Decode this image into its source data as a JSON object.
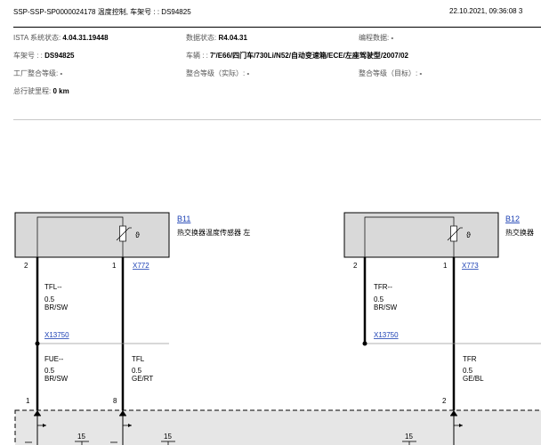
{
  "header": {
    "left": "SSP-SSP-SP0000024178 温度控制, 车架号 : : DS94825",
    "right": "22.10.2021, 09:36:08  3"
  },
  "info": {
    "istatus_label": "ISTA 系统状态: ",
    "istatus_value": "4.04.31.19448",
    "data_label": "数据状态: ",
    "data_value": "R4.04.31",
    "prog_label": "编程数据: ",
    "prog_value": "-",
    "vin_label": "车架号 : : ",
    "vin_value": "DS94825",
    "vehicle_label": "车辆 : : ",
    "vehicle_value": "7'/E66/四门车/730Li/N52/自动变速箱/ECE/左座驾驶型/2007/02",
    "factory_label": "工厂整合等级: ",
    "factory_value": "-",
    "actual_label": "整合等级（实际）: ",
    "actual_value": "-",
    "target_label": "整合等级（目标）: ",
    "target_value": "-",
    "mileage_label": "总行驶里程: ",
    "mileage_value": "0 km"
  },
  "diagram": {
    "left_component": {
      "ref": "B11",
      "description": "热交换器温度传感器 左",
      "pin_left": "2",
      "pin_right": "1",
      "connector": "X772",
      "wire_upper_name": "TFL--",
      "wire_upper_size": "0.5",
      "wire_upper_color": "BR/SW",
      "splice": "X13750",
      "wire_lower_left_name": "FUE--",
      "wire_lower_left_size": "0.5",
      "wire_lower_left_color": "BR/SW",
      "wire_lower_right_name": "TFL",
      "wire_lower_right_size": "0.5",
      "wire_lower_right_color": "GE/RT",
      "bottom_pin_left": "1",
      "bottom_pin_right": "8"
    },
    "right_component": {
      "ref": "B12",
      "description": "热交换器",
      "pin_left": "2",
      "pin_right": "1",
      "connector": "X773",
      "wire_upper_name": "TFR--",
      "wire_upper_size": "0.5",
      "wire_upper_color": "BR/SW",
      "splice": "X13750",
      "wire_lower_right_name": "TFR",
      "wire_lower_right_size": "0.5",
      "wire_lower_right_color": "GE/BL",
      "bottom_pin_right": "2"
    },
    "bottom_labels": [
      "15",
      "15",
      "15"
    ],
    "sensor_symbol": "ϑ"
  }
}
